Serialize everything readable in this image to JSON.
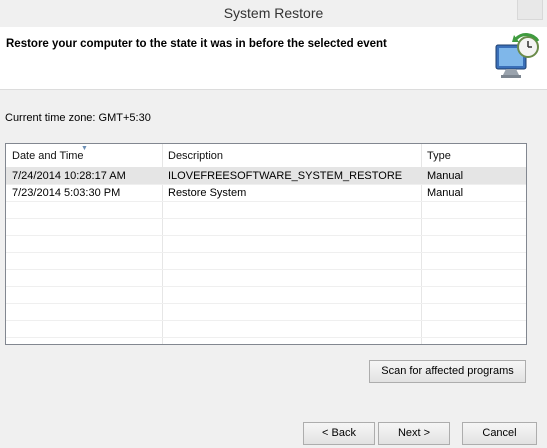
{
  "window": {
    "title": "System Restore"
  },
  "header": {
    "title": "Restore your computer to the state it was in before the selected event",
    "icon": "system-restore-icon"
  },
  "timezone": {
    "label": "Current time zone: GMT+5:30"
  },
  "table": {
    "columns": [
      "Date and Time",
      "Description",
      "Type"
    ],
    "rows": [
      {
        "date": "7/24/2014 10:28:17 AM",
        "description": "ILOVEFREESOFTWARE_SYSTEM_RESTORE",
        "type": "Manual",
        "selected": true
      },
      {
        "date": "7/23/2014 5:03:30 PM",
        "description": "Restore System",
        "type": "Manual",
        "selected": false
      }
    ]
  },
  "buttons": {
    "scan": "Scan for affected programs",
    "back": "< Back",
    "next": "Next >",
    "cancel": "Cancel"
  }
}
